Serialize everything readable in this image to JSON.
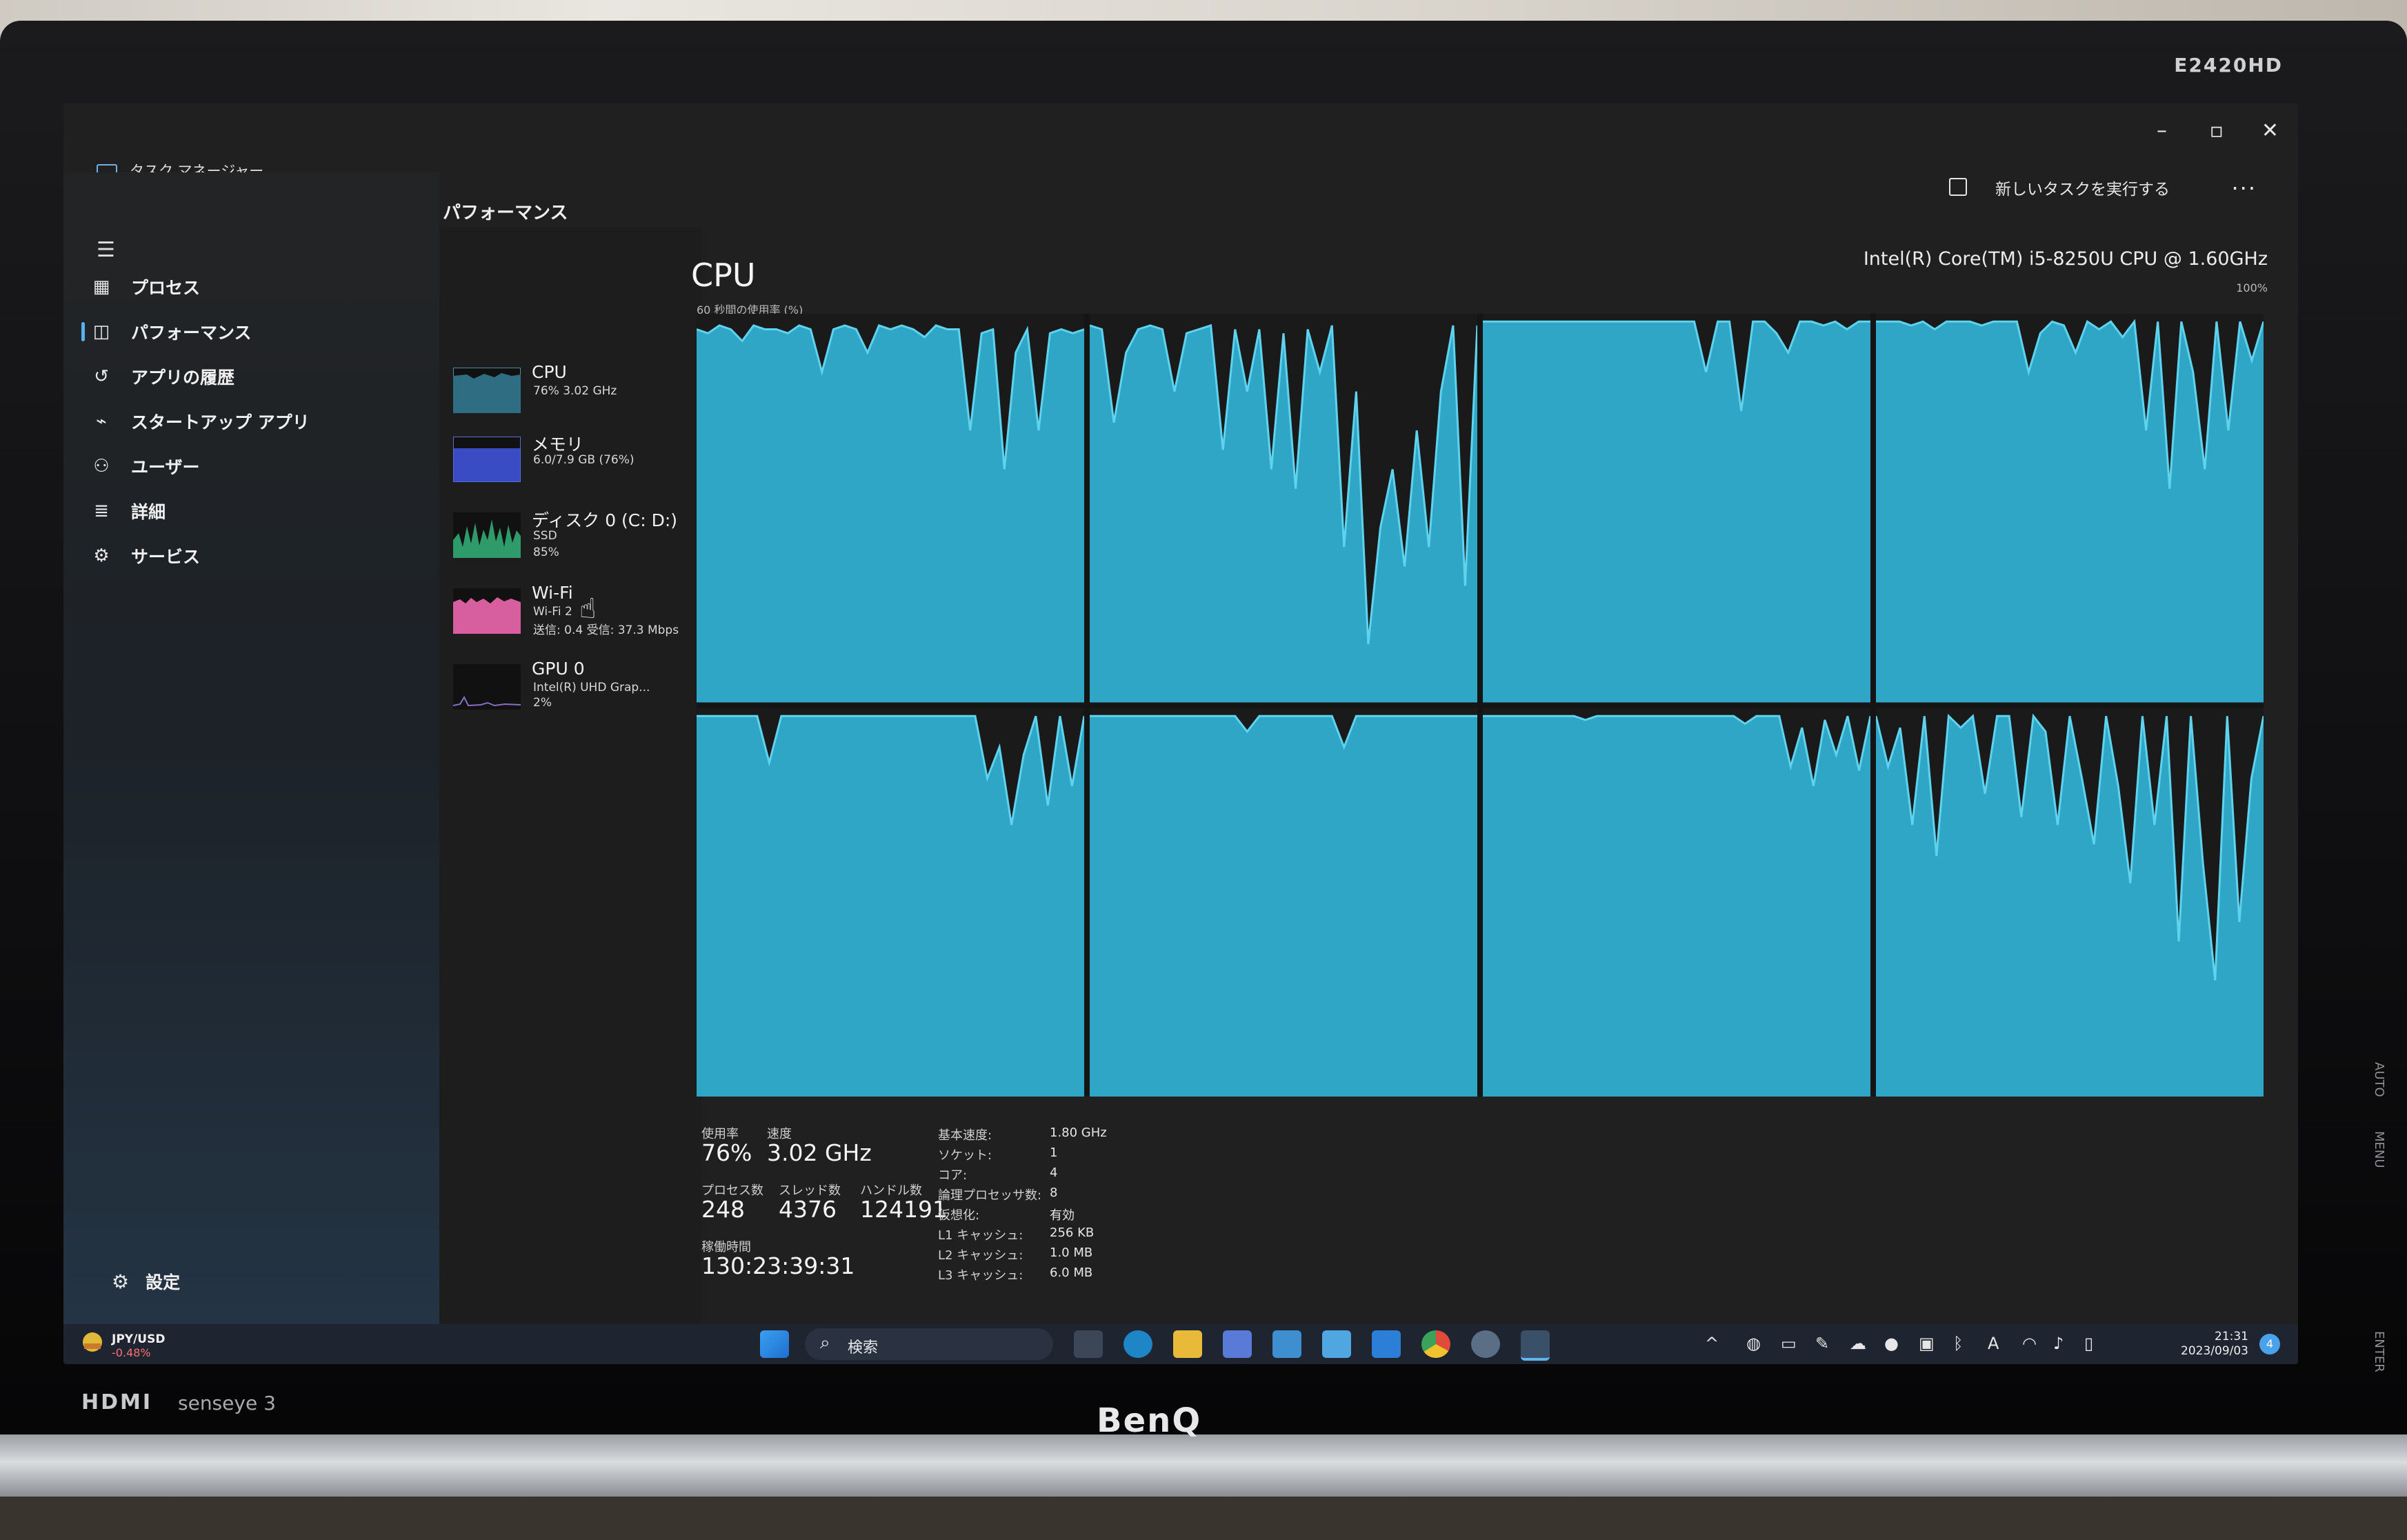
{
  "monitor": {
    "model": "E2420HD",
    "brand": "BenQ",
    "badge_hdmi": "HDMI",
    "badge_senseye": "senseye 3",
    "side_buttons": [
      "AUTO",
      "MENU",
      "ENTER"
    ]
  },
  "window": {
    "app_title": "タスク マネージャー",
    "run_new_task": "新しいタスクを実行する",
    "more": "..."
  },
  "nav": {
    "items": [
      {
        "label": "プロセス",
        "icon": "processes-icon"
      },
      {
        "label": "パフォーマンス",
        "icon": "performance-icon",
        "active": true
      },
      {
        "label": "アプリの履歴",
        "icon": "app-history-icon"
      },
      {
        "label": "スタートアップ アプリ",
        "icon": "startup-icon"
      },
      {
        "label": "ユーザー",
        "icon": "users-icon"
      },
      {
        "label": "詳細",
        "icon": "details-icon"
      },
      {
        "label": "サービス",
        "icon": "services-icon"
      }
    ],
    "settings_label": "設定"
  },
  "performance": {
    "title": "パフォーマンス",
    "devices": [
      {
        "name": "CPU",
        "sub1": "76%  3.02 GHz",
        "sub2": "",
        "sub3": "",
        "color": "#2e6d82"
      },
      {
        "name": "メモリ",
        "sub1": "6.0/7.9 GB (76%)",
        "sub2": "",
        "sub3": "",
        "color": "#3a4cc4"
      },
      {
        "name": "ディスク 0 (C: D:)",
        "sub1": "SSD",
        "sub2": "85%",
        "sub3": "",
        "color": "#2f9a6a"
      },
      {
        "name": "Wi-Fi",
        "sub1": "Wi-Fi 2",
        "sub2": "送信: 0.4  受信: 37.3 Mbps",
        "sub3": "",
        "color": "#d75fa0"
      },
      {
        "name": "GPU 0",
        "sub1": "Intel(R) UHD Grap...",
        "sub2": "2%",
        "sub3": "",
        "color": "#8a6dc8"
      }
    ]
  },
  "cpu": {
    "title": "CPU",
    "model": "Intel(R) Core(TM) i5-8250U CPU @ 1.60GHz",
    "graph_label": "60 秒間の使用率 (%)",
    "graph_max": "100%",
    "fill_color": "#2fa6c6",
    "line_color": "#5fd2ee",
    "stats": {
      "usage_label": "使用率",
      "usage_value": "76%",
      "speed_label": "速度",
      "speed_value": "3.02 GHz",
      "processes_label": "プロセス数",
      "processes_value": "248",
      "threads_label": "スレッド数",
      "threads_value": "4376",
      "handles_label": "ハンドル数",
      "handles_value": "124191",
      "uptime_label": "稼働時間",
      "uptime_value": "130:23:39:31"
    },
    "specs": [
      {
        "k": "基本速度:",
        "v": "1.80 GHz"
      },
      {
        "k": "ソケット:",
        "v": "1"
      },
      {
        "k": "コア:",
        "v": "4"
      },
      {
        "k": "論理プロセッサ数:",
        "v": "8"
      },
      {
        "k": "仮想化:",
        "v": "有効"
      },
      {
        "k": "L1 キャッシュ:",
        "v": "256 KB"
      },
      {
        "k": "L2 キャッシュ:",
        "v": "1.0 MB"
      },
      {
        "k": "L3 キャッシュ:",
        "v": "6.0 MB"
      }
    ],
    "cores": [
      [
        96,
        95,
        97,
        96,
        93,
        97,
        96,
        96,
        95,
        97,
        96,
        85,
        96,
        97,
        96,
        90,
        97,
        96,
        97,
        96,
        94,
        97,
        96,
        96,
        70,
        95,
        96,
        60,
        90,
        96,
        70,
        95,
        96,
        95,
        96
      ],
      [
        97,
        96,
        72,
        90,
        96,
        97,
        96,
        80,
        95,
        96,
        97,
        65,
        96,
        80,
        96,
        60,
        95,
        55,
        96,
        85,
        97,
        40,
        80,
        15,
        45,
        60,
        35,
        70,
        40,
        80,
        97,
        30,
        97
      ],
      [
        98,
        98,
        98,
        98,
        98,
        98,
        98,
        98,
        98,
        98,
        98,
        98,
        98,
        98,
        98,
        98,
        98,
        98,
        98,
        85,
        98,
        98,
        75,
        98,
        98,
        95,
        90,
        98,
        98,
        97,
        98,
        96,
        98,
        98
      ],
      [
        98,
        98,
        98,
        97,
        98,
        96,
        98,
        98,
        98,
        97,
        98,
        98,
        98,
        85,
        95,
        98,
        97,
        90,
        98,
        96,
        98,
        94,
        98,
        70,
        98,
        55,
        98,
        85,
        60,
        98,
        70,
        98,
        88,
        98
      ],
      [
        98,
        98,
        98,
        98,
        98,
        98,
        86,
        98,
        98,
        98,
        98,
        98,
        98,
        98,
        98,
        98,
        98,
        98,
        98,
        98,
        98,
        98,
        98,
        98,
        82,
        90,
        70,
        88,
        98,
        75,
        98,
        80,
        98
      ],
      [
        98,
        98,
        98,
        98,
        98,
        98,
        98,
        98,
        98,
        98,
        98,
        98,
        98,
        94,
        98,
        98,
        98,
        98,
        98,
        98,
        98,
        90,
        98,
        98,
        98,
        98,
        98,
        98,
        98,
        98,
        98,
        98,
        98
      ],
      [
        98,
        98,
        98,
        98,
        98,
        98,
        98,
        98,
        98,
        97,
        98,
        98,
        98,
        98,
        98,
        98,
        98,
        98,
        98,
        98,
        98,
        98,
        98,
        96,
        98,
        98,
        98,
        85,
        95,
        80,
        97,
        88,
        98,
        84,
        98
      ],
      [
        98,
        85,
        95,
        70,
        98,
        62,
        98,
        95,
        98,
        78,
        98,
        98,
        72,
        98,
        94,
        70,
        98,
        82,
        65,
        98,
        80,
        55,
        98,
        70,
        98,
        40,
        98,
        60,
        30,
        98,
        45,
        82,
        98
      ]
    ]
  },
  "taskbar": {
    "fx_name": "JPY/USD",
    "fx_change": "-0.48%",
    "search_placeholder": "検索",
    "notif_count": "4",
    "time": "21:31",
    "date": "2023/09/03"
  }
}
